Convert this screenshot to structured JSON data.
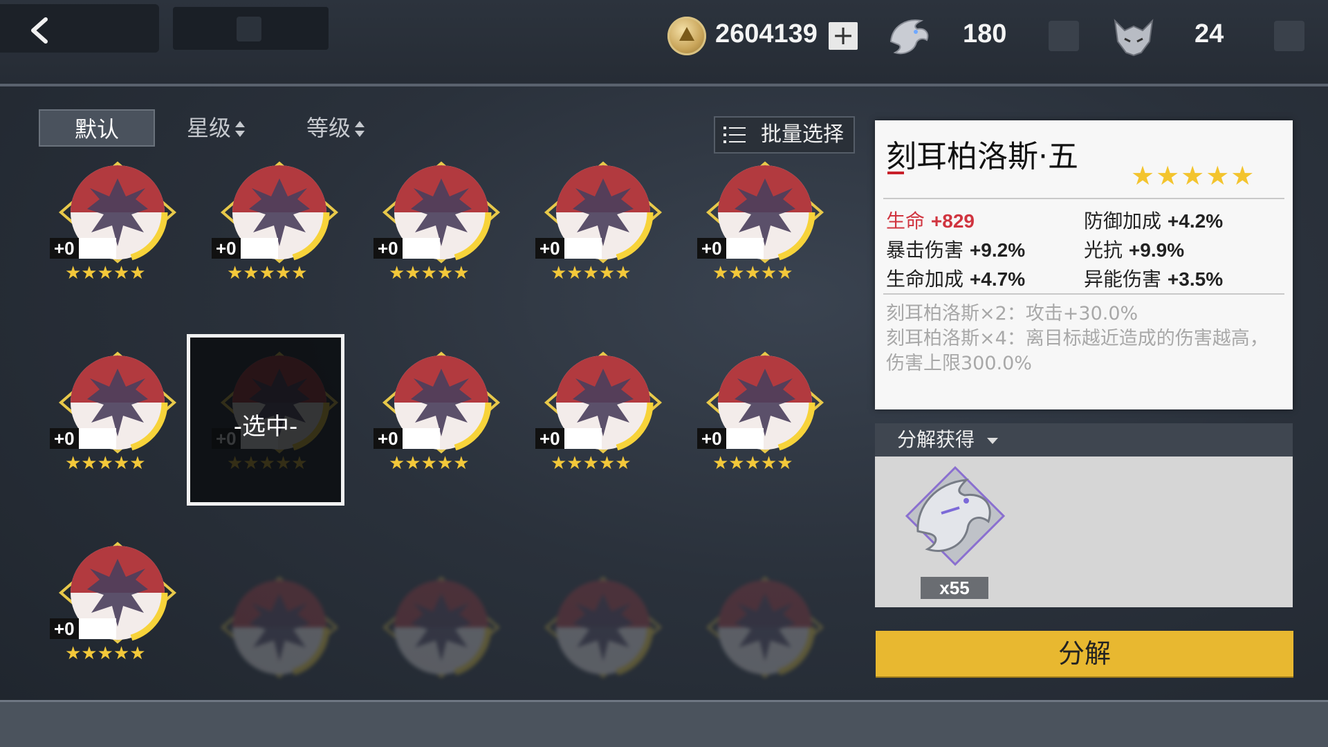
{
  "header": {
    "gold": "2604139",
    "dragon_currency": "180",
    "wolf_currency": "24"
  },
  "filters": {
    "default_label": "默认",
    "star_label": "星级",
    "level_label": "等级",
    "batch_select_label": "批量选择"
  },
  "grid": {
    "cards": [
      {
        "plus": "+0",
        "stars": "★★★★★",
        "selected": false
      },
      {
        "plus": "+0",
        "stars": "★★★★★",
        "selected": false
      },
      {
        "plus": "+0",
        "stars": "★★★★★",
        "selected": false
      },
      {
        "plus": "+0",
        "stars": "★★★★★",
        "selected": false
      },
      {
        "plus": "+0",
        "stars": "★★★★★",
        "selected": false
      },
      {
        "plus": "+0",
        "stars": "★★★★★",
        "selected": false
      },
      {
        "plus": "+0",
        "stars": "★★★★★",
        "selected": true
      },
      {
        "plus": "+0",
        "stars": "★★★★★",
        "selected": false
      },
      {
        "plus": "+0",
        "stars": "★★★★★",
        "selected": false
      },
      {
        "plus": "+0",
        "stars": "★★★★★",
        "selected": false
      },
      {
        "plus": "+0",
        "stars": "★★★★★",
        "selected": false
      }
    ],
    "selected_label": "-选中-"
  },
  "detail": {
    "name": "刻耳柏洛斯·五",
    "stars": "★★★★★",
    "main_stat": {
      "label": "生命",
      "value": "+829"
    },
    "stats": [
      {
        "label": "防御加成",
        "value": "+4.2%"
      },
      {
        "label": "暴击伤害",
        "value": "+9.2%"
      },
      {
        "label": "光抗",
        "value": "+9.9%"
      },
      {
        "label": "生命加成",
        "value": "+4.7%"
      },
      {
        "label": "异能伤害",
        "value": "+3.5%"
      }
    ],
    "set_bonus_2": "刻耳柏洛斯×2：攻击+30.0%",
    "set_bonus_4": "刻耳柏洛斯×4：离目标越近造成的伤害越高，伤害上限300.0%"
  },
  "decompose": {
    "header_label": "分解获得",
    "reward_count": "x55",
    "button_label": "分解"
  },
  "colors": {
    "accent_gold": "#e8b830",
    "main_stat_red": "#d0343f",
    "star_yellow": "#f3c83a"
  }
}
